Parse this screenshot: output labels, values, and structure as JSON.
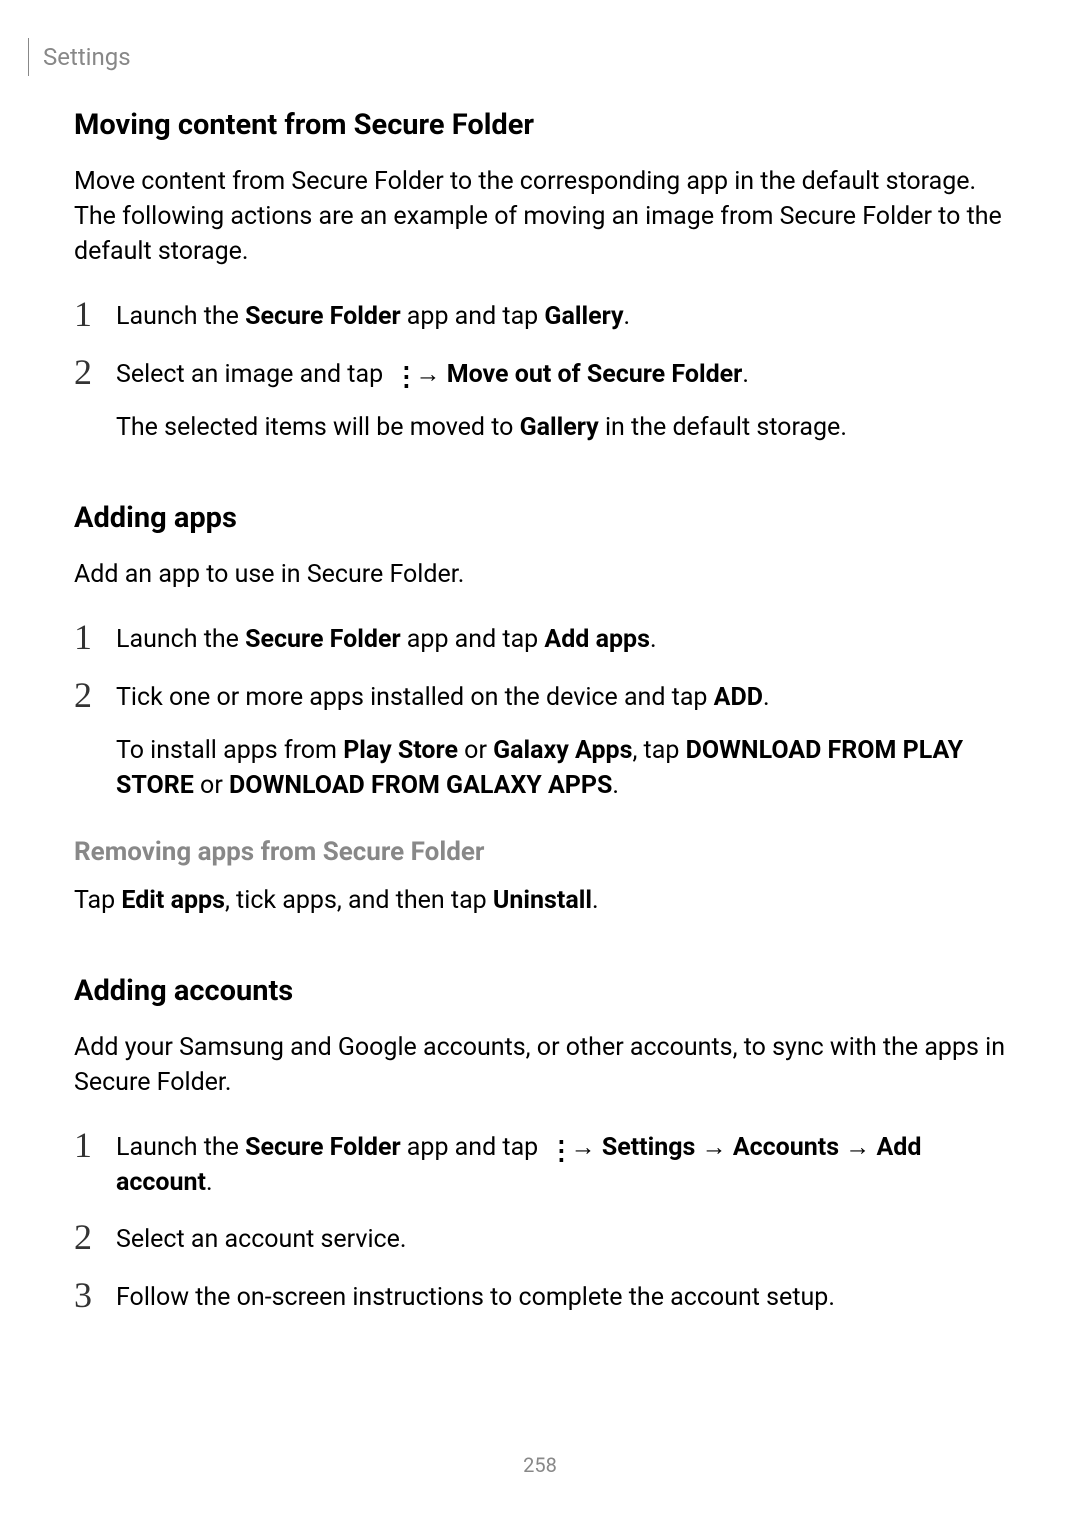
{
  "header": {
    "section": "Settings"
  },
  "sections": {
    "moving": {
      "heading": "Moving content from Secure Folder",
      "intro": "Move content from Secure Folder to the corresponding app in the default storage. The following actions are an example of moving an image from Secure Folder to the default storage.",
      "step1_prefix": "Launch the ",
      "step1_bold1": "Secure Folder",
      "step1_mid": " app and tap ",
      "step1_bold2": "Gallery",
      "step1_suffix": ".",
      "step2_prefix": "Select an image and tap ",
      "step2_arrow": " → ",
      "step2_bold": "Move out of Secure Folder",
      "step2_suffix": ".",
      "step2_sub_prefix": "The selected items will be moved to ",
      "step2_sub_bold": "Gallery",
      "step2_sub_suffix": " in the default storage."
    },
    "adding_apps": {
      "heading": "Adding apps",
      "intro": "Add an app to use in Secure Folder.",
      "step1_prefix": "Launch the ",
      "step1_bold1": "Secure Folder",
      "step1_mid": " app and tap ",
      "step1_bold2": "Add apps",
      "step1_suffix": ".",
      "step2_prefix": "Tick one or more apps installed on the device and tap ",
      "step2_bold": "ADD",
      "step2_suffix": ".",
      "step2_sub_prefix": "To install apps from ",
      "step2_sub_bold1": "Play Store",
      "step2_sub_mid1": " or ",
      "step2_sub_bold2": "Galaxy Apps",
      "step2_sub_mid2": ", tap ",
      "step2_sub_bold3": "DOWNLOAD FROM PLAY STORE",
      "step2_sub_mid3": " or ",
      "step2_sub_bold4": "DOWNLOAD FROM GALAXY APPS",
      "step2_sub_suffix": "."
    },
    "removing": {
      "heading": "Removing apps from Secure Folder",
      "text_prefix": "Tap ",
      "text_bold1": "Edit apps",
      "text_mid": ", tick apps, and then tap ",
      "text_bold2": "Uninstall",
      "text_suffix": "."
    },
    "adding_accounts": {
      "heading": "Adding accounts",
      "intro": "Add your Samsung and Google accounts, or other accounts, to sync with the apps in Secure Folder.",
      "step1_prefix": "Launch the ",
      "step1_bold1": "Secure Folder",
      "step1_mid": " app and tap ",
      "step1_arrow1": " → ",
      "step1_bold2": "Settings",
      "step1_arrow2": " → ",
      "step1_bold3": "Accounts",
      "step1_arrow3": " → ",
      "step1_bold4": "Add account",
      "step1_suffix": ".",
      "step2": "Select an account service.",
      "step3": "Follow the on-screen instructions to complete the account setup."
    }
  },
  "page_number": "258"
}
